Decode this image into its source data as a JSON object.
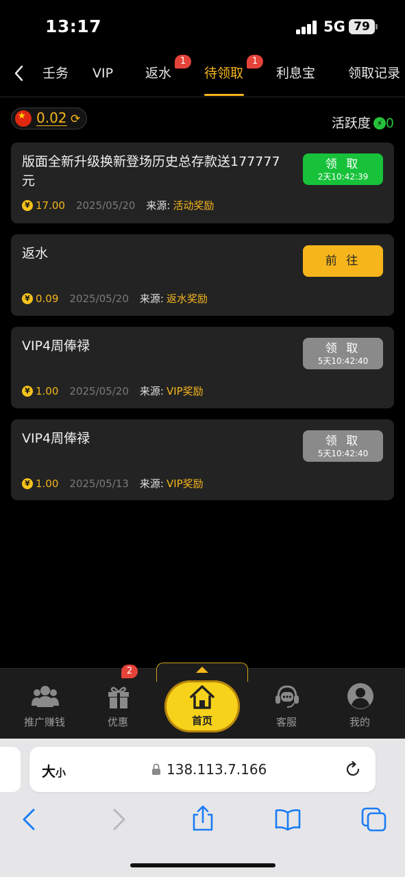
{
  "status_bar": {
    "time": "13:17",
    "network": "5G",
    "battery": "79"
  },
  "tabs": {
    "back_icon": "chevron-left-icon",
    "items": [
      {
        "label": "任务",
        "visible_label": "壬务",
        "active": false
      },
      {
        "label": "VIP",
        "active": false
      },
      {
        "label": "返水",
        "active": false,
        "badge": "1"
      },
      {
        "label": "待领取",
        "active": true,
        "badge": "1"
      },
      {
        "label": "利息宝",
        "active": false
      },
      {
        "label": "领取记录",
        "active": false
      }
    ]
  },
  "balance": {
    "value": "0.02",
    "flag_icon": "china-flag-icon",
    "refresh_icon": "refresh-icon"
  },
  "activity": {
    "label": "活跃度",
    "value": "0"
  },
  "cards": [
    {
      "title": "版面全新升级换新登场历史总存款送177777元",
      "amount": "17.00",
      "date": "2025/05/20",
      "source_label": "来源:",
      "source": "活动奖励",
      "button_label": "领 取",
      "button_timer": "2天10:42:39",
      "button_state": "green"
    },
    {
      "title": "返水",
      "amount": "0.09",
      "date": "2025/05/20",
      "source_label": "来源:",
      "source": "返水奖励",
      "button_label": "前 往",
      "button_timer": "",
      "button_state": "orange"
    },
    {
      "title": "VIP4周俸禄",
      "amount": "1.00",
      "date": "2025/05/20",
      "source_label": "来源:",
      "source": "VIP奖励",
      "button_label": "领 取",
      "button_timer": "5天10:42:40",
      "button_state": "gray"
    },
    {
      "title": "VIP4周俸禄",
      "amount": "1.00",
      "date": "2025/05/13",
      "source_label": "来源:",
      "source": "VIP奖励",
      "button_label": "领 取",
      "button_timer": "5天10:42:40",
      "button_state": "gray"
    }
  ],
  "coin_symbol": "¥",
  "bottom_nav": {
    "items": [
      {
        "label": "推广赚钱",
        "icon": "group-icon"
      },
      {
        "label": "优惠",
        "icon": "gift-icon",
        "badge": "2"
      },
      {
        "label": "首页",
        "icon": "home-icon"
      },
      {
        "label": "客服",
        "icon": "headset-icon"
      },
      {
        "label": "我的",
        "icon": "user-icon"
      }
    ]
  },
  "browser": {
    "text_size_big": "大",
    "text_size_small": "小",
    "url": "138.113.7.166",
    "lock_icon": "lock-icon",
    "reload_icon": "reload-icon",
    "toolbar_icons": [
      "back-arrow-icon",
      "forward-arrow-icon",
      "share-icon",
      "bookmarks-icon",
      "tabs-icon"
    ]
  },
  "colors": {
    "accent": "#f6b61b",
    "green": "#17c23a",
    "badge": "#e5433a",
    "card_bg": "#232323"
  }
}
